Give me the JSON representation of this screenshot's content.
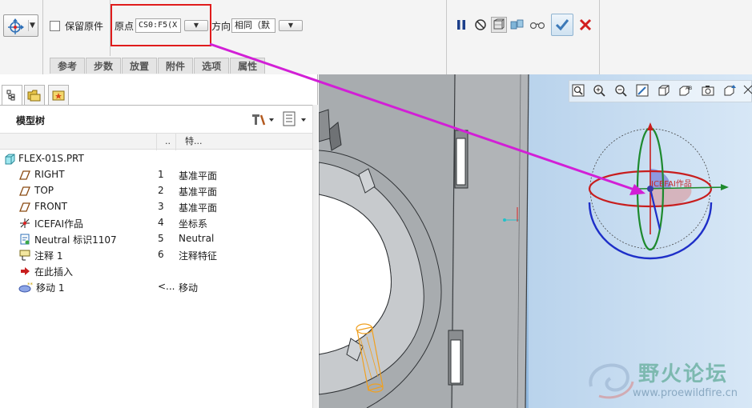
{
  "dashboard": {
    "keep_original_label": "保留原件",
    "origin_label": "原点",
    "origin_value": "CS0:F5(X",
    "direction_label": "方向",
    "direction_value": "相同（默",
    "dropdown_arrow": "▼",
    "tabs": [
      "参考",
      "步数",
      "放置",
      "附件",
      "选项",
      "属性"
    ]
  },
  "model_tree": {
    "title": "模型树",
    "col_dots": "..",
    "col_feature": "特...",
    "rows": [
      {
        "name": "FLEX-01S.PRT",
        "num": "",
        "type": "",
        "icon": "part-icon"
      },
      {
        "name": "RIGHT",
        "num": "1",
        "type": "基准平面",
        "icon": "datum-plane-icon"
      },
      {
        "name": "TOP",
        "num": "2",
        "type": "基准平面",
        "icon": "datum-plane-icon"
      },
      {
        "name": "FRONT",
        "num": "3",
        "type": "基准平面",
        "icon": "datum-plane-icon"
      },
      {
        "name": "ICEFAI作品",
        "num": "4",
        "type": "坐标系",
        "icon": "csys-icon"
      },
      {
        "name": "Neutral 标识1107",
        "num": "5",
        "type": "Neutral",
        "icon": "neutral-icon"
      },
      {
        "name": "注释 1",
        "num": "6",
        "type": "注释特征",
        "icon": "note-icon"
      },
      {
        "name": "在此插入",
        "num": "",
        "type": "",
        "icon": "insert-here-icon"
      },
      {
        "name": "移动 1",
        "num": "<...",
        "type": "移动",
        "icon": "move-feature-icon"
      }
    ]
  },
  "graphics": {
    "csys_label": "ICEFAI作品"
  },
  "watermark": {
    "text_cn": "野火论坛",
    "url": "www.proewildfire.cn"
  },
  "colors": {
    "highlight_box": "#e01c1c",
    "annotation_arrow": "#d21fd6",
    "ok_check": "#3c79b8",
    "cancel_x": "#d21e1e",
    "model_gray": "#a8acaf",
    "viewport_bg": "#9ec3e6"
  }
}
